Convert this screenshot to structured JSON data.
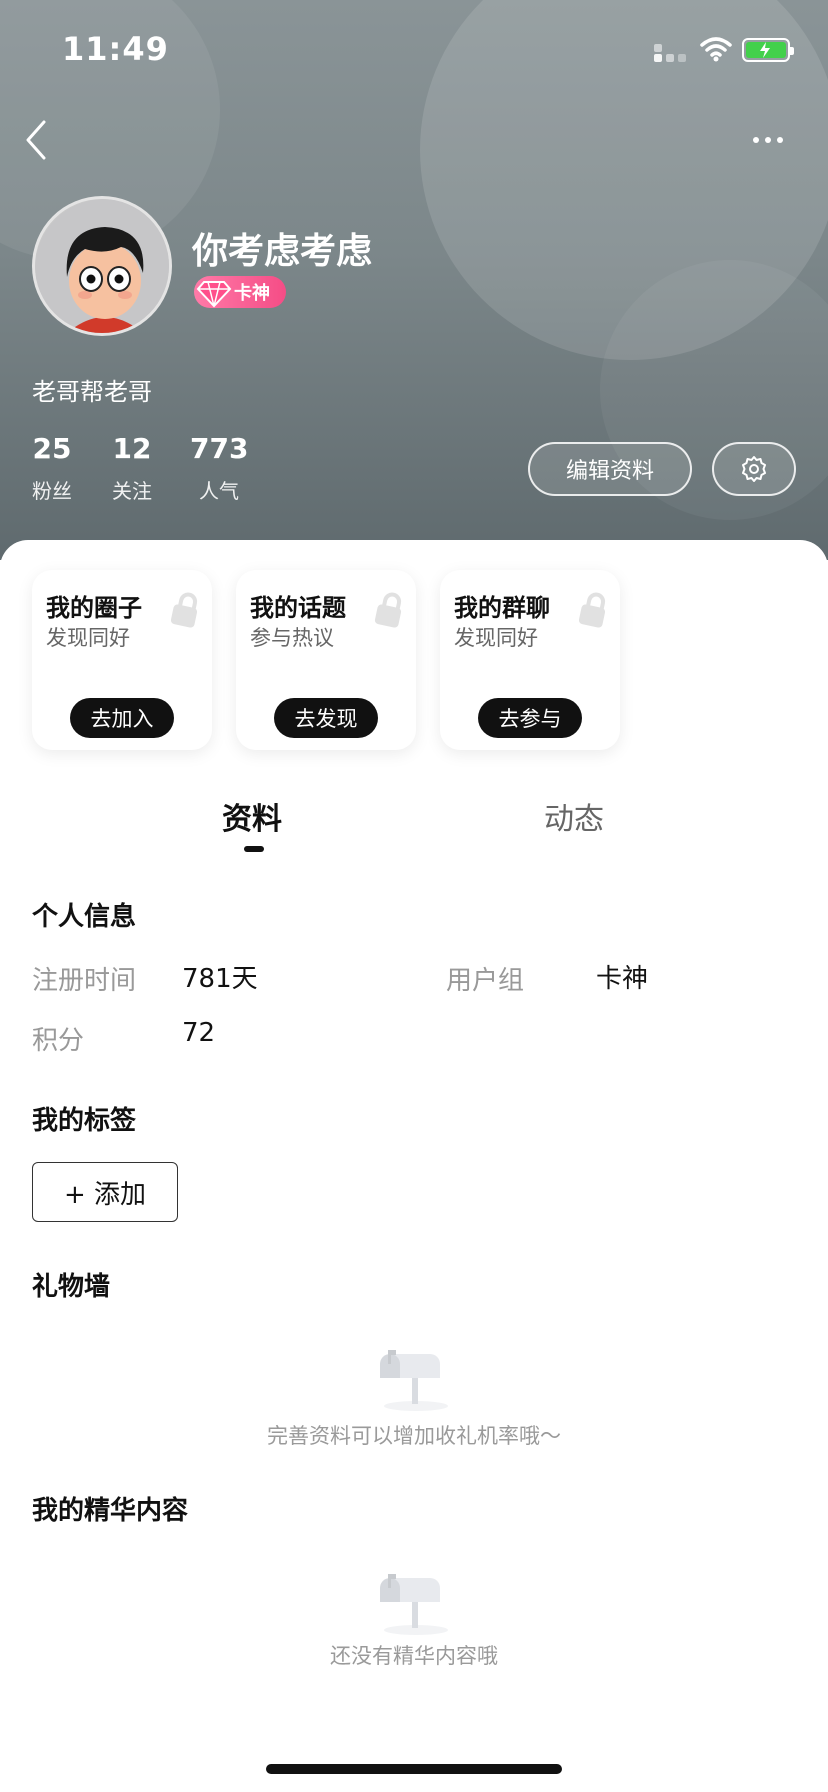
{
  "status_bar": {
    "time": "11:49"
  },
  "profile": {
    "username": "你考虑考虑",
    "badge_label": "卡神",
    "signature": "老哥帮老哥",
    "stats": [
      {
        "value": "25",
        "label": "粉丝"
      },
      {
        "value": "12",
        "label": "关注"
      },
      {
        "value": "773",
        "label": "人气"
      }
    ],
    "edit_button": "编辑资料"
  },
  "cards": [
    {
      "title": "我的圈子",
      "subtitle": "发现同好",
      "action": "去加入"
    },
    {
      "title": "我的话题",
      "subtitle": "参与热议",
      "action": "去发现"
    },
    {
      "title": "我的群聊",
      "subtitle": "发现同好",
      "action": "去参与"
    }
  ],
  "tabs": [
    {
      "label": "资料",
      "active": true
    },
    {
      "label": "动态",
      "active": false
    }
  ],
  "personal_info": {
    "title": "个人信息",
    "register_label": "注册时间",
    "register_value": "781天",
    "group_label": "用户组",
    "group_value": "卡神",
    "points_label": "积分",
    "points_value": "72"
  },
  "tags": {
    "title": "我的标签",
    "add_label": "+ 添加"
  },
  "gift_wall": {
    "title": "礼物墙",
    "empty_text": "完善资料可以增加收礼机率哦～"
  },
  "highlights": {
    "title": "我的精华内容",
    "empty_text": "还没有精华内容哦"
  },
  "colors": {
    "badge": "#f54d86",
    "battery": "#43d04b"
  }
}
